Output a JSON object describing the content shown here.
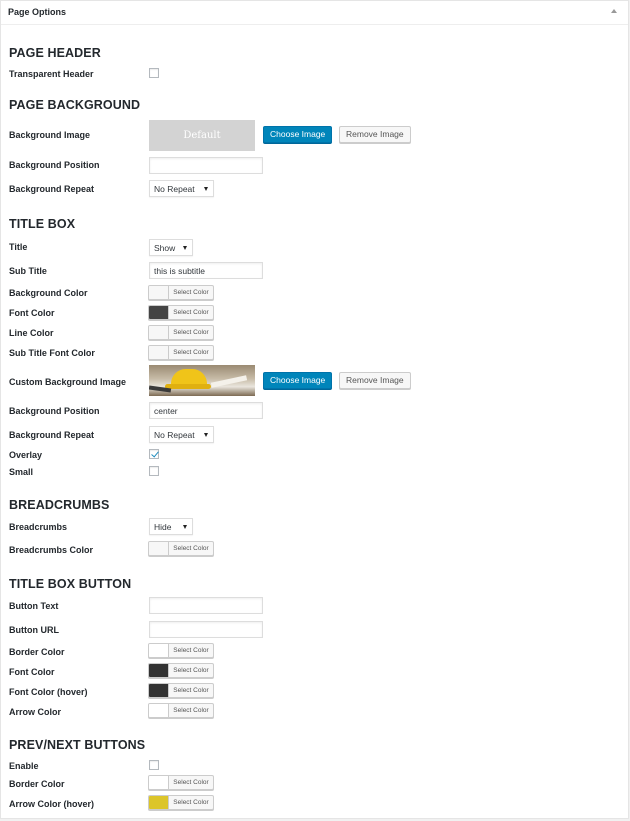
{
  "panel": {
    "title": "Page Options"
  },
  "sections": {
    "page_header": "PAGE HEADER",
    "page_background": "PAGE BACKGROUND",
    "title_box": "TITLE BOX",
    "breadcrumbs": "BREADCRUMBS",
    "title_box_button": "TITLE BOX BUTTON",
    "prev_next": "PREV/NEXT BUTTONS"
  },
  "page_header": {
    "transparent_label": "Transparent Header",
    "transparent_checked": false
  },
  "page_background": {
    "image_label": "Background Image",
    "image_placeholder": "Default",
    "choose_image": "Choose Image",
    "remove_image": "Remove Image",
    "position_label": "Background Position",
    "position_value": "",
    "repeat_label": "Background Repeat",
    "repeat_value": "No Repeat"
  },
  "title_box": {
    "title_label": "Title",
    "title_value": "Show",
    "subtitle_label": "Sub Title",
    "subtitle_value": "this is subtitle",
    "bg_color_label": "Background Color",
    "font_color_label": "Font Color",
    "line_color_label": "Line Color",
    "subtitle_font_color_label": "Sub Title Font Color",
    "custom_bg_label": "Custom Background Image",
    "choose_image": "Choose Image",
    "remove_image": "Remove Image",
    "position_label": "Background Position",
    "position_value": "center",
    "repeat_label": "Background Repeat",
    "repeat_value": "No Repeat",
    "overlay_label": "Overlay",
    "overlay_checked": true,
    "small_label": "Small",
    "small_checked": false,
    "colors": {
      "background": "#f7f7f7",
      "font": "#444444",
      "line": "#f7f7f7",
      "subtitle_font": "#f7f7f7"
    }
  },
  "breadcrumbs": {
    "breadcrumbs_label": "Breadcrumbs",
    "breadcrumbs_value": "Hide",
    "color_label": "Breadcrumbs Color",
    "color": "#f7f7f7"
  },
  "title_box_button": {
    "text_label": "Button Text",
    "text_value": "",
    "url_label": "Button URL",
    "url_value": "",
    "border_color_label": "Border Color",
    "font_color_label": "Font Color",
    "font_color_hover_label": "Font Color (hover)",
    "arrow_color_label": "Arrow Color",
    "colors": {
      "border": "#ffffff",
      "font": "#333333",
      "font_hover": "#333333",
      "arrow": "#ffffff"
    }
  },
  "prev_next": {
    "enable_label": "Enable",
    "enable_checked": false,
    "border_color_label": "Border Color",
    "arrow_color_hover_label": "Arrow Color (hover)",
    "colors": {
      "border": "#ffffff",
      "arrow_hover": "#dcc52a"
    }
  },
  "select_color_label": "Select Color",
  "accent_color": "#0085ba"
}
